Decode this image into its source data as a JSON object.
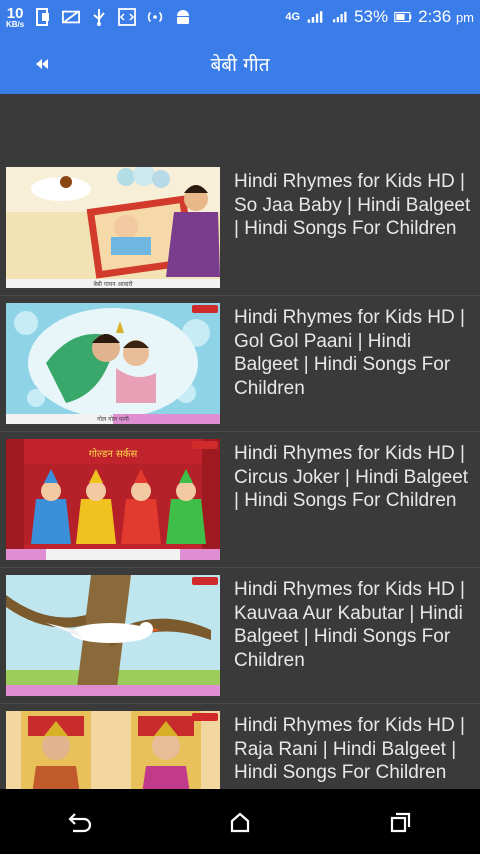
{
  "status_bar": {
    "speed_value": "10",
    "speed_unit": "KB/s",
    "network_label": "4G",
    "battery": "53%",
    "time": "2:36",
    "time_suffix": "pm"
  },
  "app_bar": {
    "title": "बेबी गीत"
  },
  "videos": [
    {
      "title": "Hindi Rhymes for Kids HD | So Jaa Baby | Hindi Balgeet | Hindi Songs For Children",
      "thumb_caption": "बेबी गायन आवारी"
    },
    {
      "title": "Hindi Rhymes for Kids HD | Gol Gol Paani | Hindi Balgeet | Hindi Songs For Children",
      "thumb_caption": "गोल गोल पानी"
    },
    {
      "title": "Hindi Rhymes for Kids HD | Circus Joker | Hindi Balgeet | Hindi Songs For Children",
      "thumb_caption": "गोल्डन सर्कस"
    },
    {
      "title": "Hindi Rhymes for Kids HD | Kauvaa Aur Kabutar | Hindi Balgeet | Hindi Songs For Children",
      "thumb_caption": ""
    },
    {
      "title": "Hindi Rhymes for Kids HD | Raja Rani | Hindi Balgeet | Hindi Songs For Children",
      "thumb_caption": ""
    }
  ],
  "colors": {
    "primary": "#3b7de8",
    "background": "#3a3a3a",
    "navbar": "#000000"
  }
}
